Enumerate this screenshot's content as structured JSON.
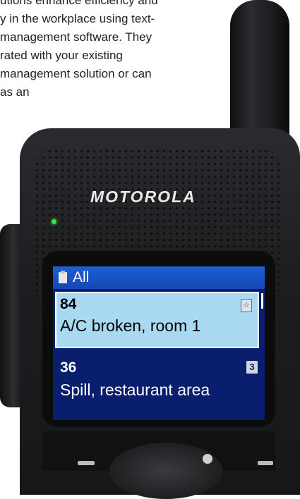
{
  "paragraph_lines": [
    "utions enhance efficiency and",
    "y in the workplace using text-",
    "management software. They",
    "rated with your existing",
    "management solution or can",
    "as an"
  ],
  "device": {
    "brand": "MOTOROLA"
  },
  "screen": {
    "header_title": "All",
    "items": [
      {
        "number": "84",
        "text": "A/C broken, room 1",
        "badge": "☆",
        "selected": true
      },
      {
        "number": "36",
        "text": "Spill, restaurant area",
        "badge": "3",
        "selected": false
      }
    ]
  },
  "colors": {
    "screen_bg": "#0a1e6e",
    "header_bg": "#1a54c8",
    "selected_row_bg": "#a9d8f1",
    "led": "#3ce04a"
  }
}
